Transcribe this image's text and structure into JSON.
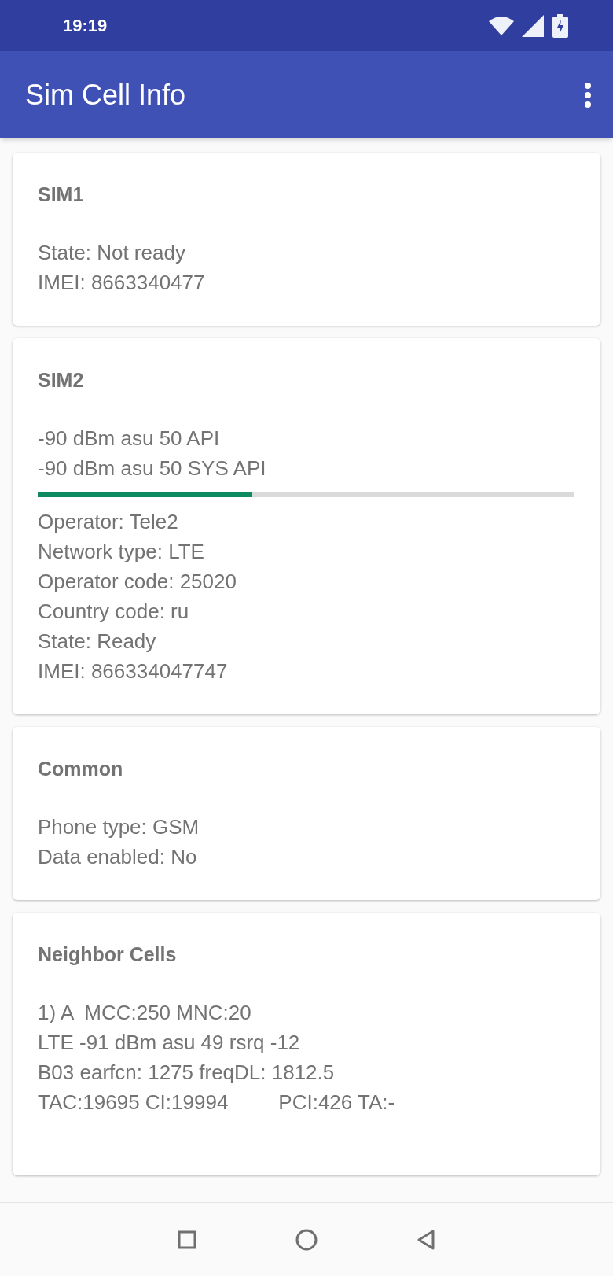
{
  "status_bar": {
    "time": "19:19"
  },
  "app_bar": {
    "title": "Sim Cell Info"
  },
  "cards": [
    {
      "title": "SIM1",
      "items": [
        {
          "kind": "text",
          "text": "State: Not ready"
        },
        {
          "kind": "text",
          "text": "IMEI: 8663340477"
        }
      ]
    },
    {
      "title": "SIM2",
      "items": [
        {
          "kind": "text",
          "text": "-90 dBm asu 50 API"
        },
        {
          "kind": "text",
          "text": "-90 dBm asu 50 SYS API"
        },
        {
          "kind": "meter",
          "level": 0.4
        },
        {
          "kind": "text",
          "text": "Operator: Tele2"
        },
        {
          "kind": "text",
          "text": "Network type: LTE"
        },
        {
          "kind": "text",
          "text": "Operator code: 25020"
        },
        {
          "kind": "text",
          "text": "Country code: ru"
        },
        {
          "kind": "text",
          "text": "State: Ready"
        },
        {
          "kind": "text",
          "text": "IMEI: 866334047747"
        }
      ]
    },
    {
      "title": "Common",
      "items": [
        {
          "kind": "text",
          "text": "Phone type: GSM"
        },
        {
          "kind": "text",
          "text": "Data enabled: No"
        }
      ]
    },
    {
      "title": "Neighbor Cells",
      "items": [
        {
          "kind": "text",
          "text": "1) A  MCC:250 MNC:20"
        },
        {
          "kind": "text",
          "text": "LTE -91 dBm asu 49 rsrq -12"
        },
        {
          "kind": "text",
          "text": "B03 earfcn: 1275 freqDL: 1812.5"
        },
        {
          "kind": "split",
          "parts": [
            "TAC:19695 CI:19994",
            "PCI:426 TA:-"
          ]
        }
      ]
    }
  ]
}
